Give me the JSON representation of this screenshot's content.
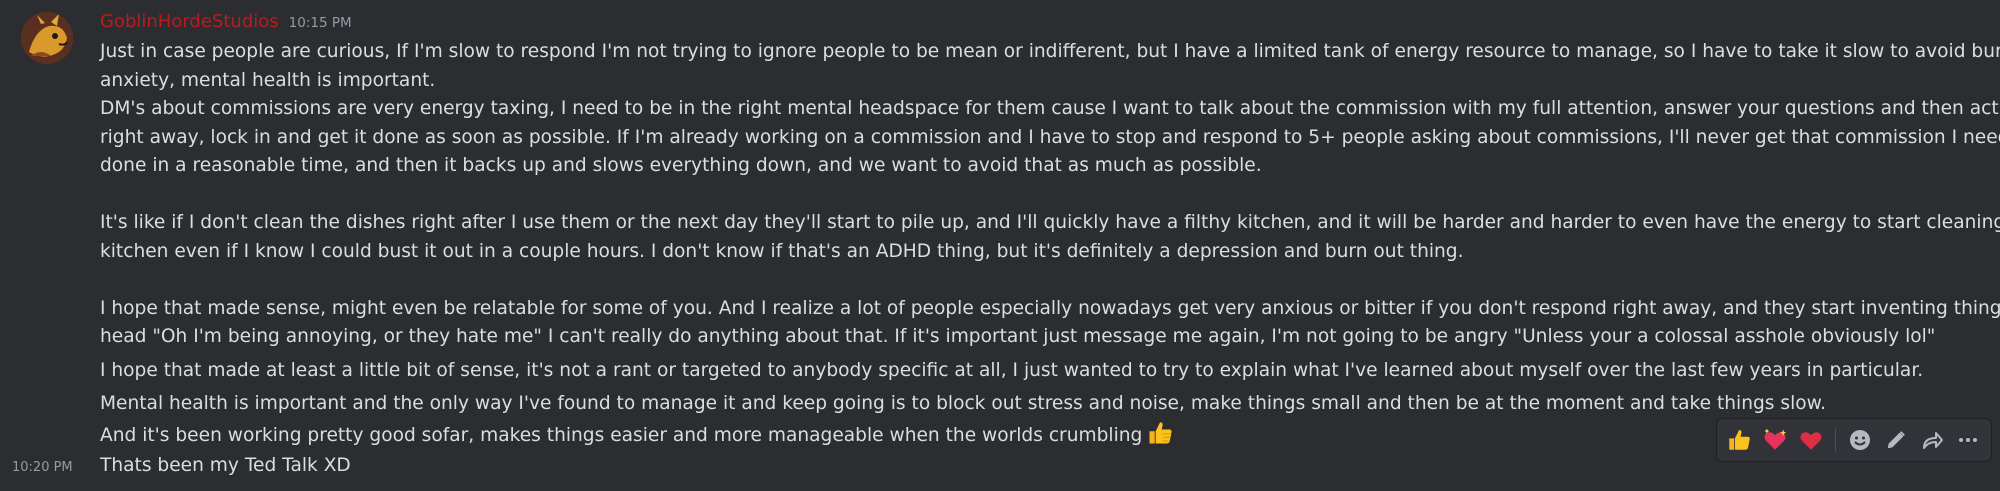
{
  "message": {
    "username": "GoblinHordeStudios",
    "timestamp": "10:15 PM",
    "lines": [
      "Just in case people are curious, If I'm slow to respond I'm not trying to ignore people to be mean or indifferent, but I have a limited tank of energy resource to manage, so I have to take it slow to avoid burn out or",
      "anxiety, mental health is important.",
      "DM's about commissions are very energy taxing, I need to be in the right mental headspace for them cause I want to talk about the commission with my full attention, answer your questions and then act upon it",
      "right away, lock in and get it done as soon as possible.   If I'm already working on a commission and I have to stop and respond to 5+ people asking about commissions, I'll never get that commission I need to finish",
      "done in a reasonable time, and then it backs up and slows everything down, and we want to avoid that as much as possible.",
      "",
      "It's like if I don't clean the dishes right after I use them or the next day they'll start to pile up, and I'll quickly have a filthy kitchen, and it will be harder and harder to even have the energy to start cleaning that",
      "kitchen even if I know I could bust it out in a couple hours. I don't know if that's an ADHD thing, but it's definitely a depression and burn out thing.",
      "",
      "I hope that made sense, might even be relatable for some of you. And I realize a lot of people especially nowadays get very anxious or bitter if you don't respond right away, and they start inventing things in their",
      "head \"Oh I'm being annoying, or they hate me\" I can't really do anything about that.  If it's important just message me again, I'm not going to be angry \"Unless your a colossal asshole obviously lol\""
    ],
    "line_para2": "I hope that made at least a little bit of sense, it's not a rant or targeted to anybody specific at all, I just wanted to try to explain what I've learned about myself over the last few years in particular.",
    "line_para3a": "Mental health is important and the only way I've found to manage it and keep going is to block out stress and noise, make things small and then be at the moment and take things slow.",
    "line_para3b": "And it's been working pretty good sofar, makes things easier and more manageable when the worlds crumbling"
  },
  "followup": {
    "timestamp": "10:20 PM",
    "text": "Thats been my Ted Talk XD"
  },
  "toolbar": {
    "items": [
      "thumbs-up-reaction",
      "sparkling-heart-reaction",
      "red-heart-reaction",
      "add-reaction",
      "edit",
      "forward",
      "more"
    ]
  },
  "colors": {
    "background": "#2b2d31",
    "username": "#b81d1d",
    "text": "#dbdee1",
    "muted": "#949ba4"
  }
}
